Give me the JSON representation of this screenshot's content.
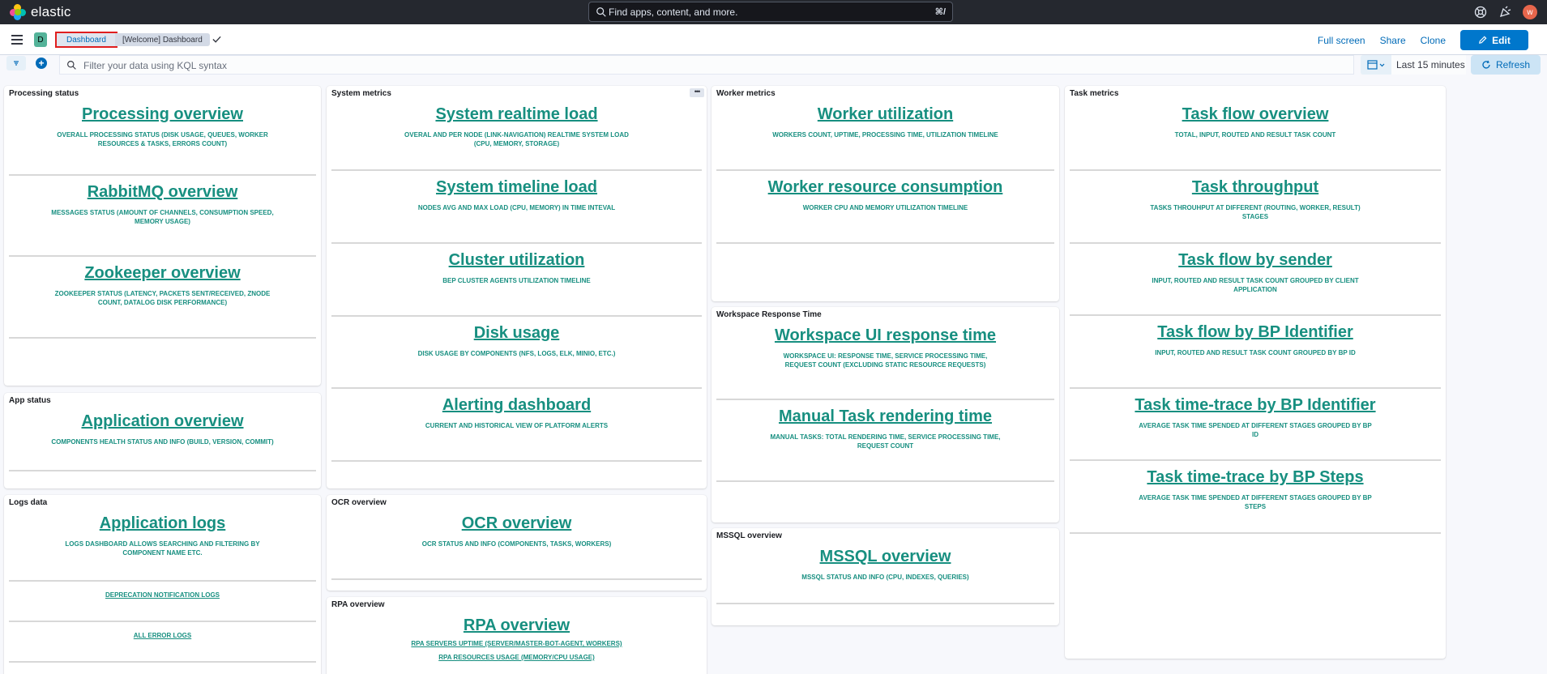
{
  "header": {
    "brand": "elastic",
    "search_placeholder": "Find apps, content, and more.",
    "search_shortcut": "⌘/",
    "avatar_initial": "w"
  },
  "subheader": {
    "space_badge": "D",
    "breadcrumb_active": "Dashboard",
    "breadcrumb_current": "[Welcome] Dashboard",
    "links": {
      "fullscreen": "Full screen",
      "share": "Share",
      "clone": "Clone"
    },
    "edit_label": "Edit"
  },
  "query": {
    "placeholder": "Filter your data using KQL syntax",
    "time_range": "Last 15 minutes",
    "refresh_label": "Refresh"
  },
  "panels": {
    "processing": {
      "title": "Processing status",
      "entries": [
        {
          "title": "Processing overview",
          "desc": "Overall processing status (disk usage, queues, worker resources & tasks, errors count)"
        },
        {
          "title": "RabbitMQ overview",
          "desc": "Messages status (amount of channels, consumption speed, memory usage)"
        },
        {
          "title": "Zookeeper overview",
          "desc": "Zookeeper status (latency, packets sent/received, znode count, datalog disk performance)"
        }
      ]
    },
    "app_status": {
      "title": "App status",
      "entries": [
        {
          "title": "Application overview",
          "desc": "Components health status and info (build, version, commit)"
        }
      ]
    },
    "logs": {
      "title": "Logs data",
      "entries": [
        {
          "title": "Application logs",
          "desc": "Logs dashboard allows searching and filtering by component name etc."
        }
      ],
      "links": [
        "DEPRECATION NOTIFICATION LOGS",
        "ALL ERROR LOGS"
      ]
    },
    "system": {
      "title": "System metrics",
      "entries": [
        {
          "title": "System realtime load",
          "desc": "Overal and per node (link-navigation) realtime system load (CPU, memory, storage)"
        },
        {
          "title": "System timeline load",
          "desc": "Nodes AVG and MAX load (CPU, memory) in time inteval"
        },
        {
          "title": "Cluster utilization",
          "desc": "BEP cluster agents utilization timeline"
        },
        {
          "title": "Disk usage",
          "desc": "Disk usage by components (NFS, logs, ELK, MinIO, etc.)"
        },
        {
          "title": "Alerting dashboard",
          "desc": "Current and historical view of platform alerts"
        }
      ]
    },
    "ocr": {
      "title": "OCR overview",
      "entries": [
        {
          "title": "OCR overview",
          "desc": "OCR status and info (components, tasks, workers)"
        }
      ]
    },
    "rpa": {
      "title": "RPA overview",
      "entries": [
        {
          "title": "RPA overview"
        }
      ],
      "links": [
        "RPA SERVERS UPTIME (SERVER/MASTER-BOT-AGENT, WORKERS)",
        "RPA RESOURCES USAGE (MEMORY/CPU USAGE)"
      ]
    },
    "worker": {
      "title": "Worker metrics",
      "entries": [
        {
          "title": "Worker utilization",
          "desc": "Workers count, uptime, processing time, utilization timeline"
        },
        {
          "title": "Worker resource consumption",
          "desc": "Worker CPU and memory utilization timeline"
        }
      ]
    },
    "workspace": {
      "title": "Workspace Response Time",
      "entries": [
        {
          "title": "Workspace UI response time",
          "desc": "Workspace UI: response time, service processing time, request count (excluding static resource requests)"
        },
        {
          "title": "Manual Task rendering time",
          "desc": "Manual tasks: total rendering time, service processing time, request count"
        }
      ]
    },
    "mssql": {
      "title": "MSSQL overview",
      "entries": [
        {
          "title": "MSSQL overview",
          "desc": "MSSQL status and info (CPU, indexes, queries)"
        }
      ]
    },
    "task": {
      "title": "Task metrics",
      "entries": [
        {
          "title": "Task flow overview",
          "desc": "Total, input, routed and result task count"
        },
        {
          "title": "Task throughput",
          "desc": "Tasks throuhput at different (routing, worker, result) stages"
        },
        {
          "title": "Task flow by sender",
          "desc": "Input, routed and result task count grouped by client application"
        },
        {
          "title": "Task flow by BP Identifier",
          "desc": "Input, routed and result task count grouped by BP ID"
        },
        {
          "title": "Task time-trace by BP Identifier",
          "desc": "Average task time spended at different stages grouped by BP ID"
        },
        {
          "title": "Task time-trace by BP Steps",
          "desc": "Average task time spended at different stages grouped by BP steps"
        }
      ]
    }
  }
}
